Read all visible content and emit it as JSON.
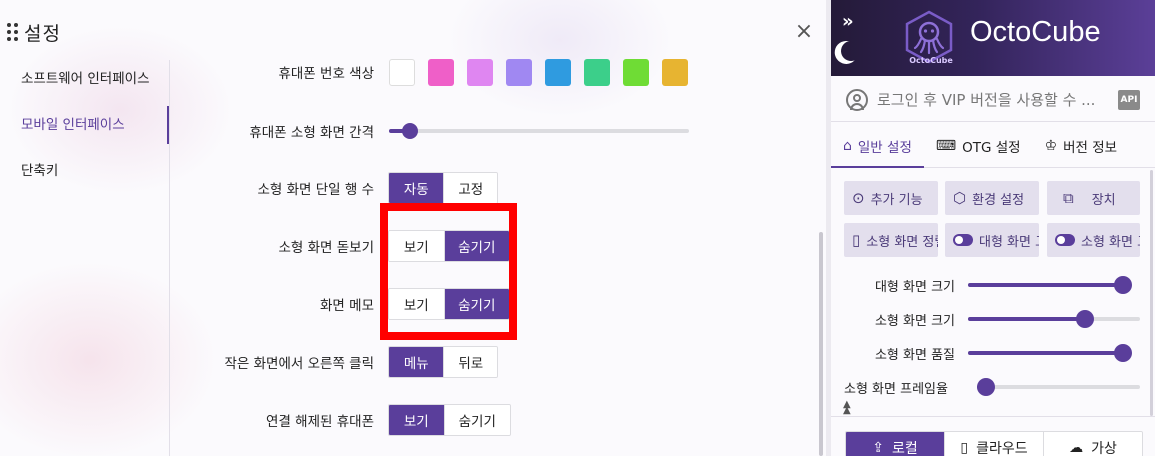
{
  "settings": {
    "title": "설정",
    "close_glyph": "×",
    "nav": [
      {
        "label": "소프트웨어 인터페이스",
        "active": false
      },
      {
        "label": "모바일 인터페이스",
        "active": true
      },
      {
        "label": "단축키",
        "active": false
      }
    ],
    "phone_number_color": {
      "label": "휴대폰 번호 색상",
      "swatches": [
        "#ffffff",
        "#ef5fc8",
        "#df86f1",
        "#a088f2",
        "#2f9be0",
        "#3ccf8a",
        "#6fdc35",
        "#e7b431"
      ]
    },
    "small_screen_spacing": {
      "label": "휴대폰 소형 화면 간격",
      "value_fraction": 0.07
    },
    "single_row_count": {
      "label": "소형 화면 단일 행 수",
      "options": [
        "자동",
        "고정"
      ],
      "selected": 0
    },
    "magnifier": {
      "label": "소형 화면 돋보기",
      "options": [
        "보기",
        "숨기기"
      ],
      "selected": 1
    },
    "screen_memo": {
      "label": "화면 메모",
      "options": [
        "보기",
        "숨기기"
      ],
      "selected": 1
    },
    "right_click": {
      "label": "작은 화면에서 오른쪽 클릭",
      "options": [
        "메뉴",
        "뒤로"
      ],
      "selected": 0
    },
    "disconnected_phone": {
      "label": "연결 해제된 휴대폰",
      "options": [
        "보기",
        "숨기기"
      ],
      "selected": 0
    }
  },
  "panel": {
    "brand": "OctoCube",
    "logo_text": "OctoCube",
    "expand_icon": "»",
    "login_text": "로그인 후 VIP 버전을 사용할 수 ...",
    "api_badge": "API",
    "tabs": [
      {
        "label": "일반 설정",
        "icon": "home-icon",
        "active": true
      },
      {
        "label": "OTG 설정",
        "icon": "keyboard-icon",
        "active": false
      },
      {
        "label": "버전 정보",
        "icon": "crown-icon",
        "active": false
      }
    ],
    "buttons_row1": [
      {
        "label": "추가 기능",
        "icon": "more-icon"
      },
      {
        "label": "환경 설정",
        "icon": "hexagon-settings-icon"
      },
      {
        "label": "장치",
        "icon": "devices-icon"
      }
    ],
    "buttons_row2": [
      {
        "label": "소형 화면 정렬",
        "icon": "phone-layout-icon"
      },
      {
        "label": "대형 화면 고정",
        "icon": "toggle-icon"
      },
      {
        "label": "소형 화면 고정",
        "icon": "toggle-icon"
      }
    ],
    "sliders": [
      {
        "label": "대형 화면 크기",
        "value_fraction": 1.0
      },
      {
        "label": "소형 화면 크기",
        "value_fraction": 0.7
      },
      {
        "label": "소형 화면 품질",
        "value_fraction": 1.0
      },
      {
        "label": "소형 화면 프레임율",
        "value_fraction": 0.0
      }
    ],
    "bottom_tabs": [
      {
        "label": "로컬",
        "icon": "upload-icon",
        "selected": true
      },
      {
        "label": "클라우드",
        "icon": "phone-icon",
        "selected": false
      },
      {
        "label": "가상",
        "icon": "cloud-icon",
        "selected": false
      }
    ]
  }
}
